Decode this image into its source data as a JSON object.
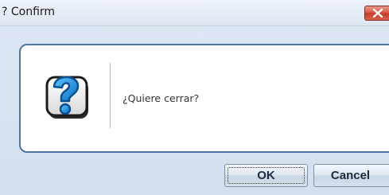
{
  "window": {
    "title": "? Confirm"
  },
  "dialog": {
    "message": "¿Quiere cerrar?",
    "icon": "question-icon"
  },
  "buttons": {
    "ok_label": "OK",
    "cancel_label": "Cancel"
  },
  "colors": {
    "panel_border": "#4f74a2",
    "icon_blue": "#1f8fd8",
    "close_red": "#d8543f"
  }
}
